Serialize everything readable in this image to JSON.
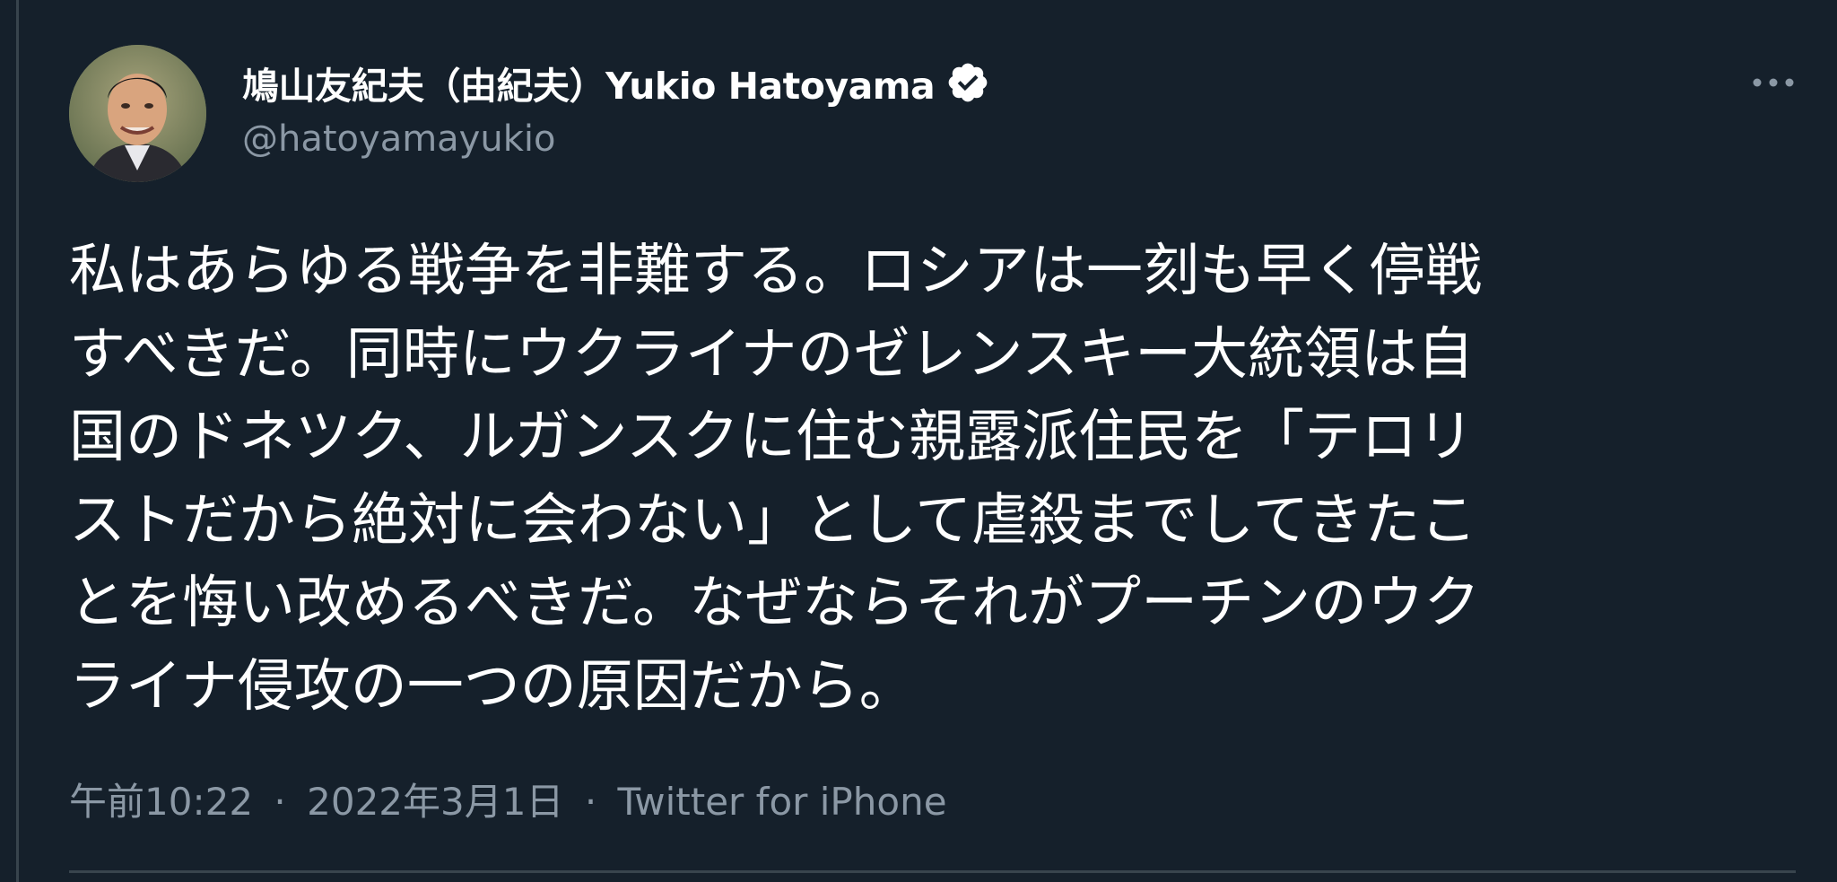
{
  "tweet": {
    "author_name": "鳩山友紀夫（由紀夫）Yukio Hatoyama",
    "handle": "@hatoyamayukio",
    "text": "私はあらゆる戦争を非難する。ロシアは一刻も早く停戦\nすべきだ。同時にウクライナのゼレンスキー大統領は自\n国のドネツク、ルガンスクに住む親露派住民を「テロリ\nストだから絶対に会わない」として虐殺までしてきたこ\nとを悔い改めるべきだ。なぜならそれがプーチンのウク\nライナ侵攻の一つの原因だから。",
    "time": "午前10:22",
    "date": "2022年3月1日",
    "source": "Twitter for iPhone",
    "separator": "·"
  },
  "icons": {
    "verified": "verified-badge-icon",
    "more": "more-options-icon"
  },
  "colors": {
    "background": "#15202b",
    "text": "#ffffff",
    "secondary_text": "#8b98a5",
    "border": "#38444d"
  }
}
